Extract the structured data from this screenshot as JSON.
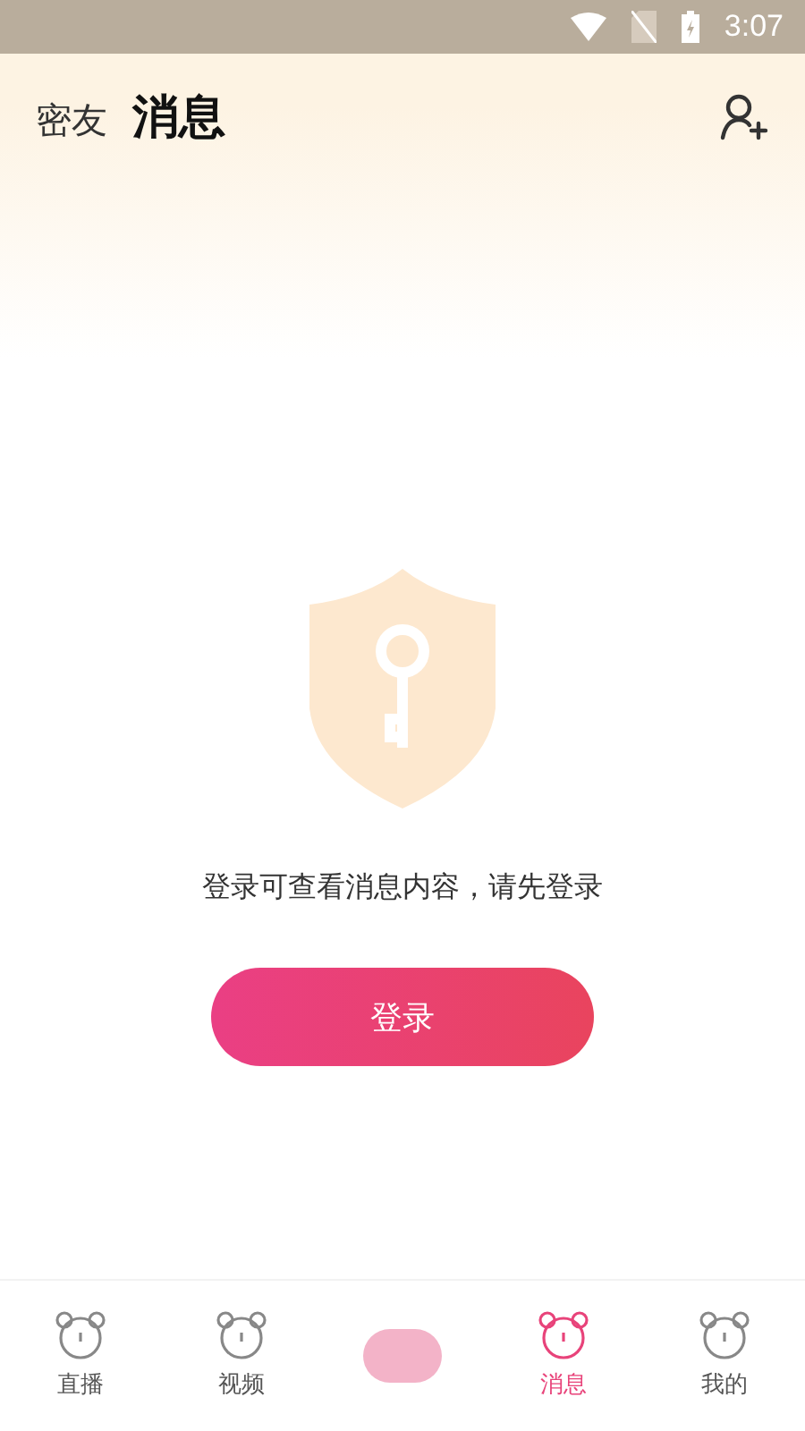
{
  "status_bar": {
    "time": "3:07"
  },
  "header": {
    "tabs": [
      {
        "label": "密友",
        "selected": false
      },
      {
        "label": "消息",
        "selected": true
      }
    ]
  },
  "empty_state": {
    "message": "登录可查看消息内容，请先登录",
    "button": "登录"
  },
  "bottom_nav": [
    {
      "kind": "tab",
      "label": "直播",
      "selected": false
    },
    {
      "kind": "tab",
      "label": "视频",
      "selected": false
    },
    {
      "kind": "center"
    },
    {
      "kind": "tab",
      "label": "消息",
      "selected": true
    },
    {
      "kind": "tab",
      "label": "我的",
      "selected": false
    }
  ]
}
